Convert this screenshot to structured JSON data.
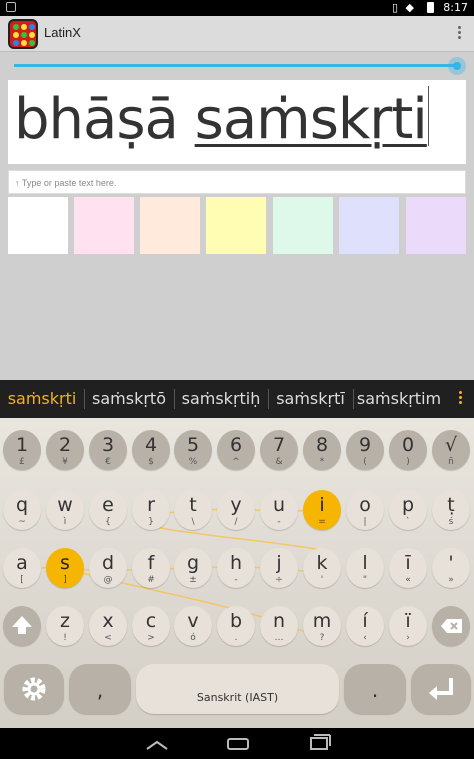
{
  "status_bar": {
    "time": "8:17"
  },
  "app": {
    "title": "LatinX"
  },
  "display": {
    "text_plain": "bhāṣā ",
    "text_underlined": "saṁskṛti"
  },
  "input": {
    "placeholder": "↑ Type or paste text here."
  },
  "swatch_colors": [
    "#ffffff",
    "#ffe1ef",
    "#ffeadb",
    "#fffcb4",
    "#def9ea",
    "#dfe0fb",
    "#ecdafb"
  ],
  "suggestions": [
    "saṁskṛti",
    "saṁskṛtō",
    "saṁskṛtiḥ",
    "saṁskṛtī",
    "saṁskṛtim"
  ],
  "keyboard": {
    "rows": [
      [
        [
          "1",
          "£"
        ],
        [
          "2",
          "¥"
        ],
        [
          "3",
          "€"
        ],
        [
          "4",
          "$"
        ],
        [
          "5",
          "%"
        ],
        [
          "6",
          "^"
        ],
        [
          "7",
          "&"
        ],
        [
          "8",
          "*"
        ],
        [
          "9",
          "("
        ],
        [
          "0",
          ")"
        ],
        [
          "√",
          "ñ"
        ]
      ],
      [
        [
          "q",
          "~"
        ],
        [
          "w",
          "ì"
        ],
        [
          "e",
          "{"
        ],
        [
          "r",
          "}"
        ],
        [
          "t",
          "\\"
        ],
        [
          "y",
          "/"
        ],
        [
          "u",
          "-"
        ],
        [
          "i",
          "="
        ],
        [
          "o",
          "|"
        ],
        [
          "p",
          "`"
        ],
        [
          "ṭ",
          "ś"
        ]
      ],
      [
        [
          "a",
          "["
        ],
        [
          "s",
          "]"
        ],
        [
          "d",
          "@"
        ],
        [
          "f",
          "#"
        ],
        [
          "g",
          "±"
        ],
        [
          "h",
          "‑"
        ],
        [
          "j",
          "÷"
        ],
        [
          "k",
          "'"
        ],
        [
          "l",
          "\""
        ],
        [
          "ī",
          "«"
        ],
        [
          "'",
          "»"
        ]
      ],
      [
        [
          "z",
          "!"
        ],
        [
          "x",
          "<"
        ],
        [
          "c",
          ">"
        ],
        [
          "v",
          "ó"
        ],
        [
          "b",
          "."
        ],
        [
          "n",
          "…"
        ],
        [
          "m",
          "?"
        ],
        [
          "í",
          "‹"
        ],
        [
          "ï",
          "›"
        ]
      ]
    ],
    "highlighted": [
      "i",
      "s"
    ],
    "comma_label": ",",
    "period_label": ".",
    "space_label": "Sanskrit (IAST)"
  },
  "accent_color": "#f6b500",
  "icons": [
    "app-icon",
    "overflow-menu-icon",
    "shift-icon",
    "backspace-icon",
    "settings-icon",
    "enter-icon",
    "back-icon",
    "home-icon",
    "recents-icon"
  ]
}
